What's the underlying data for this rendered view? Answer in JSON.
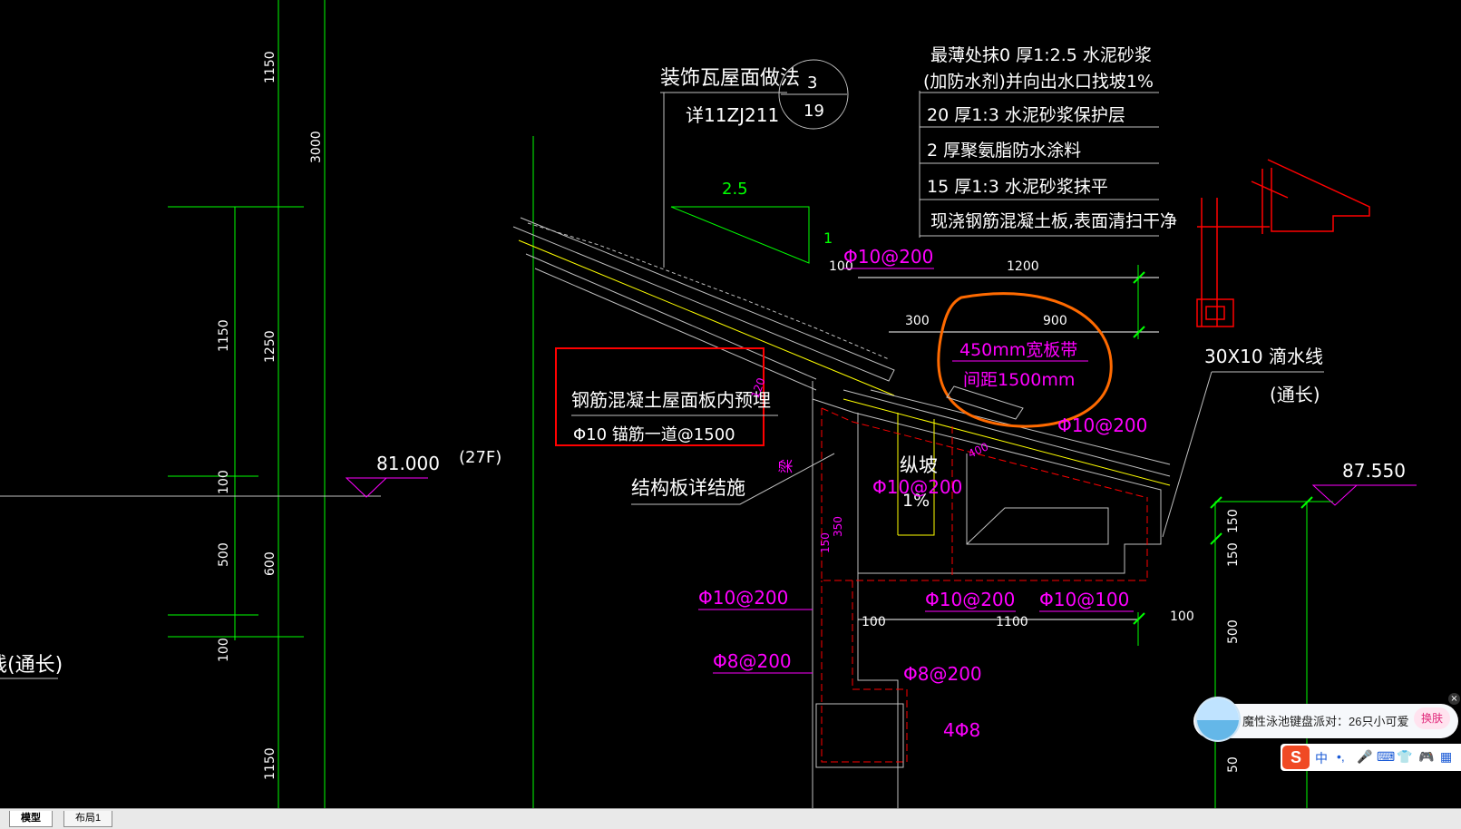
{
  "drawing": {
    "ornamental_tile_note": "装饰瓦屋面做法",
    "ornamental_tile_ref": "详11ZJ211",
    "detail_index_top": "3",
    "detail_index_bottom": "19",
    "layers": [
      "最薄处抹0 厚1:2.5  水泥砂浆",
      "(加防水剂)并向出水口找坡1%",
      "20 厚1:3  水泥砂浆保护层",
      "2 厚聚氨脂防水涂料",
      "15 厚1:3  水泥砂浆抹平",
      "现浇钢筋混凝土板,表面清扫干净"
    ],
    "slope_value": "2.5",
    "slope_one": "1",
    "anchor_note_line1": "钢筋混凝土屋面板内预埋",
    "anchor_note_line2": "Φ10  锚筋一道@1500",
    "structure_note": "结构板详结施",
    "beam_label": "梁",
    "gutter_label": "纵坡",
    "gutter_slope": "1%",
    "wide_band_1": "450mm宽板带",
    "wide_band_2": "间距1500mm",
    "drip_line_1": "30X10  滴水线",
    "drip_line_2": "(通长)",
    "left_partial_note": "线(通长)",
    "elev_left": "81.000",
    "floor_tag": "(27F)",
    "elev_right": "87.550",
    "dims_left_outer": [
      "1150",
      "3000",
      "1150"
    ],
    "dims_left_mid": [
      "1250",
      "600"
    ],
    "dims_left_inner": [
      "1150",
      "100",
      "500",
      "100"
    ],
    "dims_top": [
      "1200",
      "300",
      "900",
      "100"
    ],
    "dims_bottom": [
      "100",
      "1100",
      "100"
    ],
    "dims_right": [
      "150",
      "150",
      "500",
      "50"
    ],
    "dim_small": [
      "120",
      "400",
      "350",
      "150",
      "150",
      "100",
      "1100"
    ],
    "rebar": {
      "r1": "Φ10@200",
      "r2": "Φ10@200",
      "r3": "Φ10@200",
      "r4": "Φ10@200",
      "r5": "Φ10@100",
      "r6": "Φ10@200",
      "r7": "Φ8@200",
      "r8": "Φ8@200",
      "r9": "4Φ8"
    }
  },
  "tabs": {
    "model": "模型",
    "layout": "布局1"
  },
  "ime": {
    "message": "魔性泳池键盘派对：26只小可爱",
    "skin_button": "换肤",
    "close": "×",
    "logo": "S",
    "buttons": [
      "中",
      "•,",
      "🎤",
      "⌨",
      "👕",
      "🎮",
      "▦"
    ]
  },
  "colors": {
    "green": "#00ff00",
    "magenta": "#ff00ff",
    "red": "#ff0000",
    "yellow": "#ffff00",
    "white": "#ffffff",
    "orange": "#ff6a00",
    "gray": "#c0c0c0"
  }
}
